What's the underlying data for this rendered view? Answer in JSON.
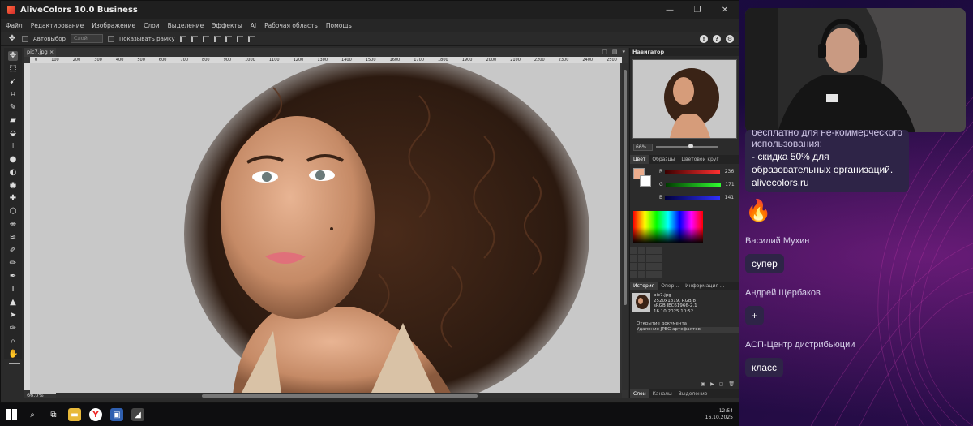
{
  "app": {
    "title": "AliveColors 10.0 Business",
    "menu": [
      "Файл",
      "Редактирование",
      "Изображение",
      "Слои",
      "Выделение",
      "Эффекты",
      "AI",
      "Рабочая область",
      "Помощь"
    ],
    "options": {
      "autoselect_label": "Автовыбор",
      "layer_select": "Слой",
      "show_frame_label": "Показывать рамку"
    },
    "doc_tab": "pic7.jpg",
    "ruler_ticks": [
      "0",
      "100",
      "200",
      "300",
      "400",
      "500",
      "600",
      "700",
      "800",
      "900",
      "1000",
      "1100",
      "1200",
      "1300",
      "1400",
      "1500",
      "1600",
      "1700",
      "1800",
      "1900",
      "2000",
      "2100",
      "2200",
      "2300",
      "2400",
      "2500"
    ],
    "zoom_status": "66.0%",
    "navigator": {
      "title": "Навигатор",
      "zoom": "66%"
    },
    "color_tabs": [
      "Цвет",
      "Образцы",
      "Цветовой круг"
    ],
    "color": {
      "r": "236",
      "g": "171",
      "b": "141",
      "fg": "#ecad8d"
    },
    "history_tabs": [
      "История",
      "Опер...",
      "Информация ..."
    ],
    "history": {
      "file": "pic7.jpg",
      "size": "2520x1819, RGB/8",
      "profile": "sRGB IEC61966-2.1",
      "date": "16.10.2025 10:52",
      "steps": [
        "Открытие документа",
        "Удаление JPEG артефактов"
      ]
    },
    "layer_tabs": [
      "Слои",
      "Каналы",
      "Выделение"
    ]
  },
  "taskbar": {
    "time": "12:54",
    "date": "16.10.2025"
  },
  "chat": {
    "promo_cut_line": "бесплатно для не-коммерческого",
    "promo_lines": [
      "использования;",
      "- скидка 50% для",
      "образовательных организаций.",
      "alivecolors.ru"
    ],
    "reaction": "🔥",
    "messages": [
      {
        "author": "Василий Мухин",
        "text": "супер"
      },
      {
        "author": "Андрей Щербаков",
        "text": "+"
      },
      {
        "author": "АСП-Центр дистрибьюции",
        "text": "класс"
      }
    ]
  }
}
